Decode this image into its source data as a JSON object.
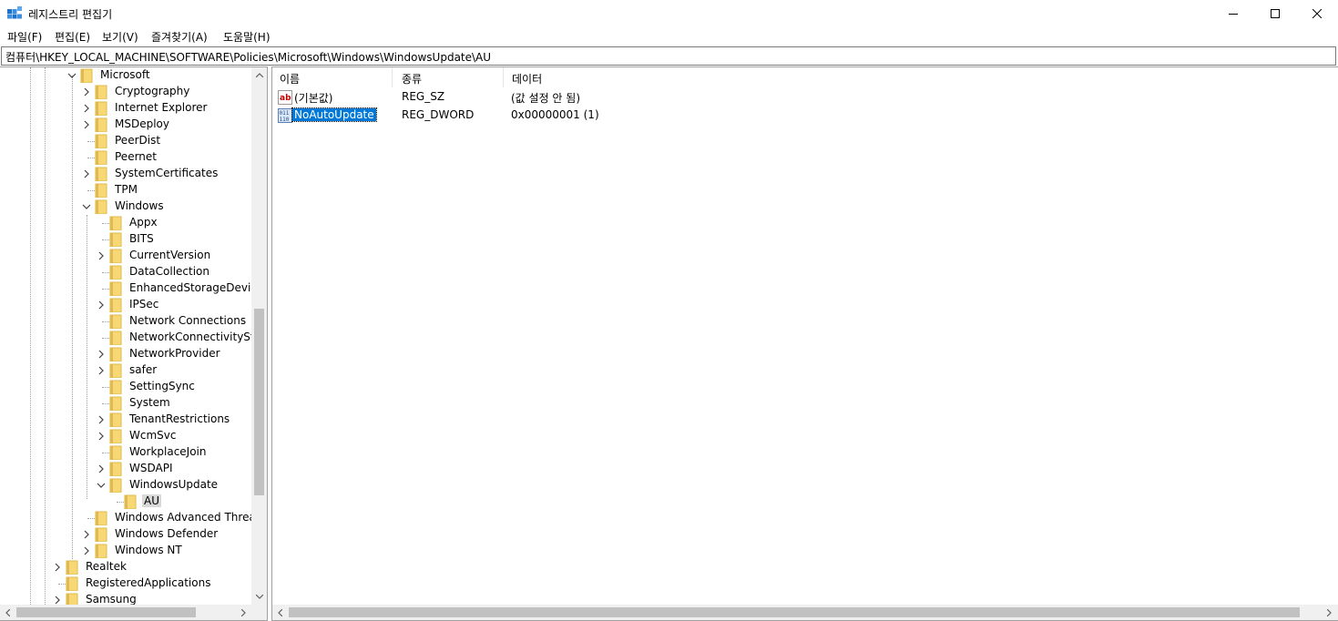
{
  "window": {
    "title": "레지스트리 편집기"
  },
  "menu": [
    "파일(F)",
    "편집(E)",
    "보기(V)",
    "즐겨찾기(A)",
    "도움말(H)"
  ],
  "address": "컴퓨터\\HKEY_LOCAL_MACHINE\\SOFTWARE\\Policies\\Microsoft\\Windows\\WindowsUpdate\\AU",
  "tree": [
    {
      "label": "Microsoft",
      "depth": 0,
      "state": "expanded"
    },
    {
      "label": "Cryptography",
      "depth": 1,
      "state": "collapsed"
    },
    {
      "label": "Internet Explorer",
      "depth": 1,
      "state": "collapsed"
    },
    {
      "label": "MSDeploy",
      "depth": 1,
      "state": "collapsed"
    },
    {
      "label": "PeerDist",
      "depth": 1,
      "state": "leaf"
    },
    {
      "label": "Peernet",
      "depth": 1,
      "state": "leaf"
    },
    {
      "label": "SystemCertificates",
      "depth": 1,
      "state": "collapsed"
    },
    {
      "label": "TPM",
      "depth": 1,
      "state": "leaf"
    },
    {
      "label": "Windows",
      "depth": 1,
      "state": "expanded"
    },
    {
      "label": "Appx",
      "depth": 2,
      "state": "leaf"
    },
    {
      "label": "BITS",
      "depth": 2,
      "state": "leaf"
    },
    {
      "label": "CurrentVersion",
      "depth": 2,
      "state": "collapsed"
    },
    {
      "label": "DataCollection",
      "depth": 2,
      "state": "leaf"
    },
    {
      "label": "EnhancedStorageDevices",
      "depth": 2,
      "state": "leaf"
    },
    {
      "label": "IPSec",
      "depth": 2,
      "state": "collapsed"
    },
    {
      "label": "Network Connections",
      "depth": 2,
      "state": "leaf"
    },
    {
      "label": "NetworkConnectivityStatu",
      "depth": 2,
      "state": "leaf"
    },
    {
      "label": "NetworkProvider",
      "depth": 2,
      "state": "collapsed"
    },
    {
      "label": "safer",
      "depth": 2,
      "state": "collapsed"
    },
    {
      "label": "SettingSync",
      "depth": 2,
      "state": "leaf"
    },
    {
      "label": "System",
      "depth": 2,
      "state": "leaf"
    },
    {
      "label": "TenantRestrictions",
      "depth": 2,
      "state": "collapsed"
    },
    {
      "label": "WcmSvc",
      "depth": 2,
      "state": "collapsed"
    },
    {
      "label": "WorkplaceJoin",
      "depth": 2,
      "state": "leaf"
    },
    {
      "label": "WSDAPI",
      "depth": 2,
      "state": "collapsed"
    },
    {
      "label": "WindowsUpdate",
      "depth": 2,
      "state": "expanded"
    },
    {
      "label": "AU",
      "depth": 3,
      "state": "selected"
    },
    {
      "label": "Windows Advanced Threat P",
      "depth": 1,
      "state": "leaf"
    },
    {
      "label": "Windows Defender",
      "depth": 1,
      "state": "collapsed"
    },
    {
      "label": "Windows NT",
      "depth": 1,
      "state": "collapsed"
    },
    {
      "label": "Realtek",
      "depth": -1,
      "state": "collapsed"
    },
    {
      "label": "RegisteredApplications",
      "depth": -1,
      "state": "leaf"
    },
    {
      "label": "Samsung",
      "depth": -1,
      "state": "collapsed"
    }
  ],
  "columns": {
    "name": "이름",
    "type": "종류",
    "data": "데이터"
  },
  "values": [
    {
      "name": "(기본값)",
      "type": "REG_SZ",
      "data": "(값 설정 안 됨)",
      "icon": "string-value-icon",
      "selected": false
    },
    {
      "name": "NoAutoUpdate",
      "type": "REG_DWORD",
      "data": "0x00000001 (1)",
      "icon": "dword-value-icon",
      "selected": true
    }
  ],
  "colors": {
    "selection": "#0078d7",
    "folder": "#f8d775",
    "folder_dark": "#e1b94f"
  }
}
